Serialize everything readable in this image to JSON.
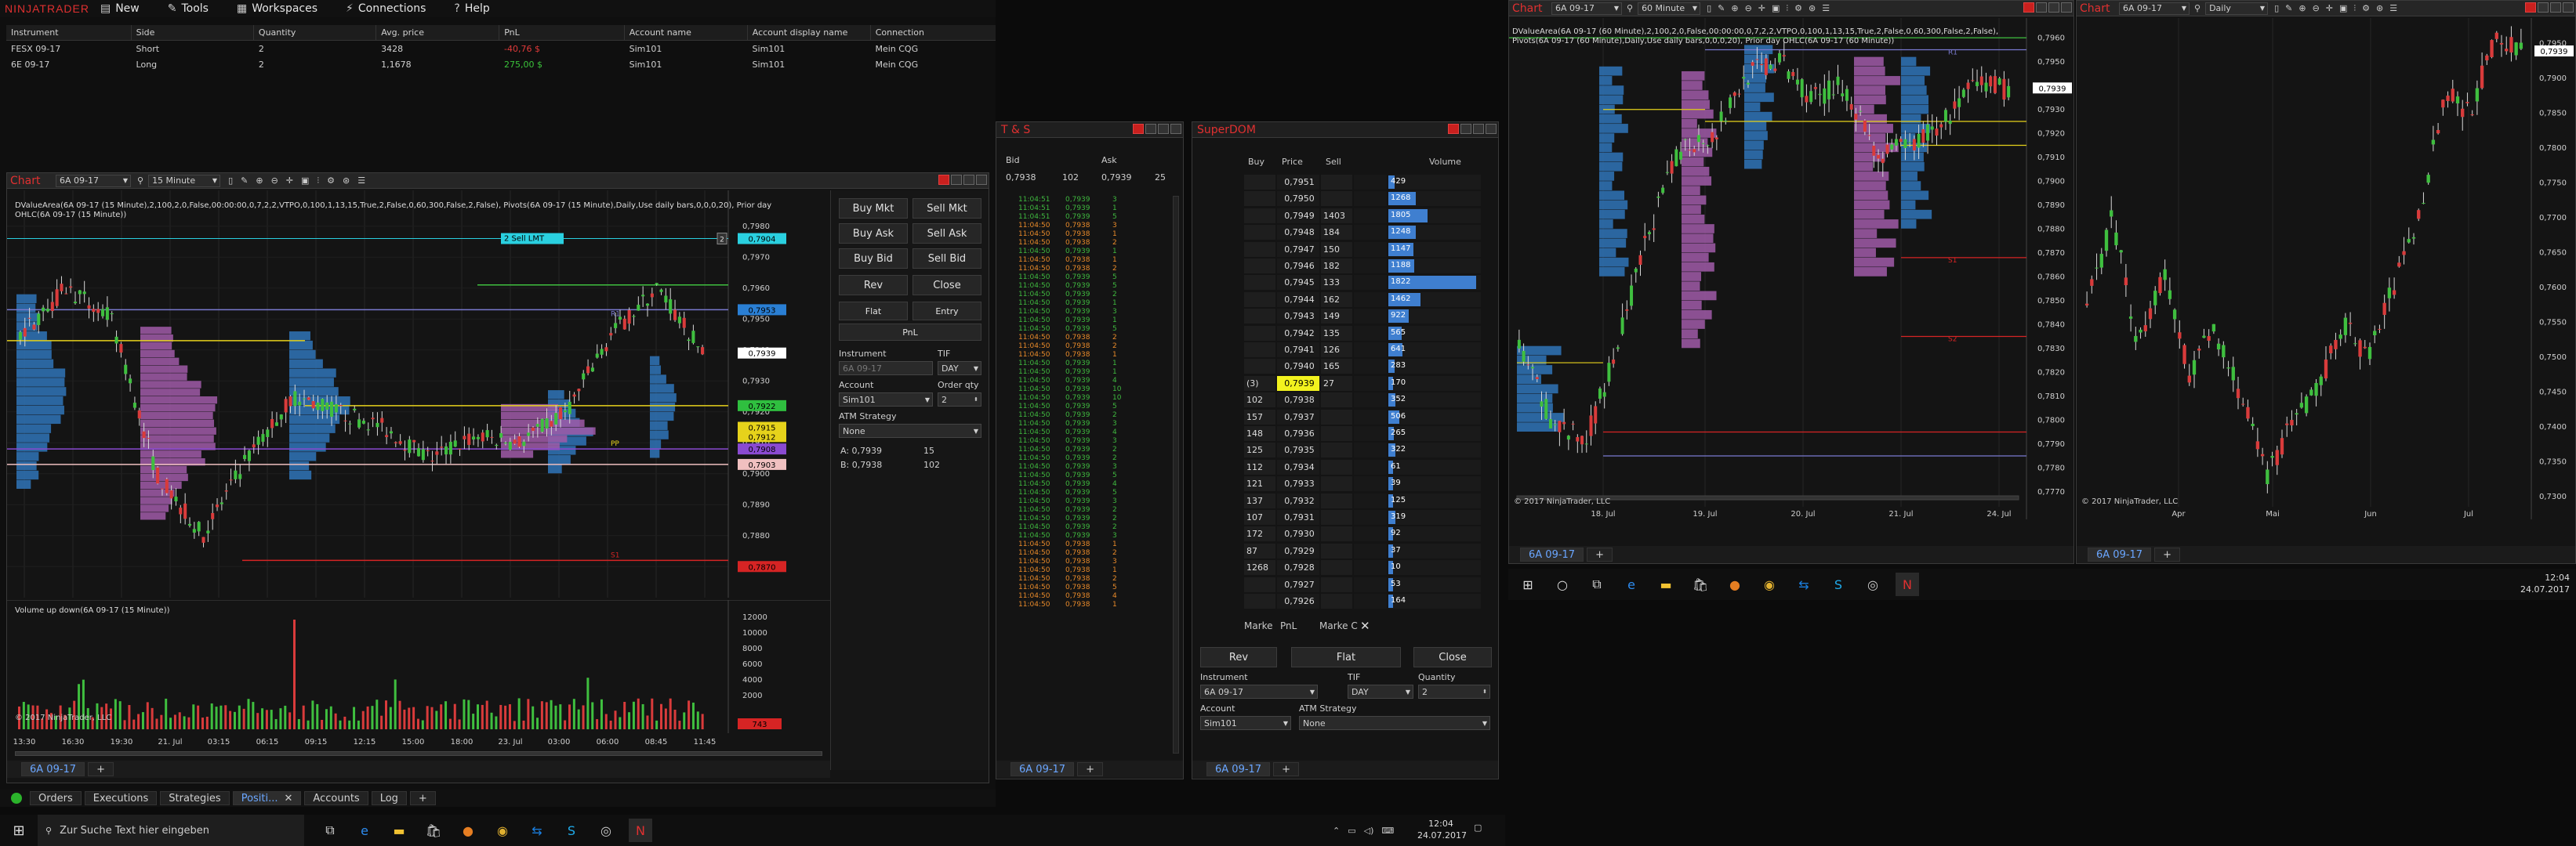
{
  "control_center": {
    "logo": "NINJATRADER",
    "menu": [
      "New",
      "Tools",
      "Workspaces",
      "Connections",
      "Help"
    ],
    "positions_headers": [
      "Instrument",
      "Side",
      "Quantity",
      "Avg. price",
      "PnL",
      "Account name",
      "Account display name",
      "Connection"
    ],
    "positions": [
      {
        "instrument": "FESX 09-17",
        "side": "Short",
        "quantity": "2",
        "avg_price": "3428",
        "pnl": "-40,76 $",
        "account": "Sim101",
        "display": "Sim101",
        "connection": "Mein CQG",
        "pnl_color": "#e03a3a"
      },
      {
        "instrument": "6E 09-17",
        "side": "Long",
        "quantity": "2",
        "avg_price": "1,1678",
        "pnl": "275,00 $",
        "account": "Sim101",
        "display": "Sim101",
        "connection": "Mein CQG",
        "pnl_color": "#3ac23a"
      }
    ],
    "bottom_tabs": [
      "Orders",
      "Executions",
      "Strategies",
      "Positi...",
      "Accounts",
      "Log"
    ],
    "active_bottom_tab": "Positi..."
  },
  "main_chart": {
    "title": "Chart",
    "instrument": "6A 09-17",
    "interval": "15 Minute",
    "info_text": "DValueArea(6A 09-17 (15 Minute),2,100,2,0,False,00:00:00,0,7,2,2,VTPO,0,100,1,13,15,True,2,False,0,60,300,False,2,False), Pivots(6A 09-17 (15 Minute),Daily,Use daily bars,0,0,0,20), Prior day OHLC(6A 09-17 (15 Minute))",
    "sell_order_label": "2  Sell LMT",
    "order_price": "0,7904",
    "order_qty": "2",
    "r1_label": "R1",
    "pp_label": "PP",
    "s1_label": "S1",
    "y_ticks": [
      "0,7980",
      "0,7970",
      "0,7960",
      "0,7950",
      "0,7940",
      "0,7930",
      "0,7920",
      "0,7910",
      "0,7900",
      "0,7890",
      "0,7880",
      "0,7870"
    ],
    "price_tags": [
      {
        "text": "0,7953",
        "bg": "#2a7fd4"
      },
      {
        "text": "0,7939",
        "bg": "#ffffff"
      },
      {
        "text": "0,7922",
        "bg": "#2fbf3f"
      },
      {
        "text": "0,7915",
        "bg": "#e6d21b"
      },
      {
        "text": "0,7912",
        "bg": "#e6d21b"
      },
      {
        "text": "0,7908",
        "bg": "#8a4ad1"
      },
      {
        "text": "0,7903",
        "bg": "#f0c0c0"
      },
      {
        "text": "0,7870",
        "bg": "#d62424"
      }
    ],
    "volume_label": "Volume up down(6A 09-17 (15 Minute))",
    "volume_ticks": [
      "12000",
      "10000",
      "8000",
      "6000",
      "4000",
      "2000"
    ],
    "volume_last": "743",
    "copyright": "© 2017 NinjaTrader, LLC",
    "x_ticks": [
      "13:30",
      "16:30",
      "19:30",
      "21. Jul",
      "03:15",
      "06:15",
      "09:15",
      "12:15",
      "15:00",
      "18:00",
      "23. Jul",
      "03:00",
      "06:00",
      "08:45",
      "11:45"
    ],
    "tab": "6A 09-17"
  },
  "chart_trader": {
    "buy_mkt": "Buy Mkt",
    "sell_mkt": "Sell Mkt",
    "buy_ask": "Buy Ask",
    "sell_ask": "Sell Ask",
    "buy_bid": "Buy Bid",
    "sell_bid": "Sell Bid",
    "rev": "Rev",
    "close": "Close",
    "flat": "Flat",
    "entry": "Entry",
    "pnl": "PnL",
    "instrument_label": "Instrument",
    "instrument_value": "6A 09-17",
    "tif_label": "TIF",
    "tif_value": "DAY",
    "account_label": "Account",
    "account_value": "Sim101",
    "order_qty_label": "Order qty",
    "order_qty_value": "2",
    "atm_label": "ATM Strategy",
    "atm_value": "None",
    "ask_line": "A:  0,7939",
    "ask_size": "15",
    "bid_line": "B:  0,7938",
    "bid_size": "102"
  },
  "ts": {
    "title": "T & S",
    "bid_label": "Bid",
    "ask_label": "Ask",
    "bid_price": "0,7938",
    "bid_size": "102",
    "ask_price": "0,7939",
    "ask_size": "25",
    "rows": [
      [
        "11:04:51",
        "0,7939",
        "3",
        "g"
      ],
      [
        "11:04:51",
        "0,7939",
        "1",
        "g"
      ],
      [
        "11:04:51",
        "0,7939",
        "5",
        "g"
      ],
      [
        "11:04:50",
        "0,7938",
        "3",
        "o"
      ],
      [
        "11:04:50",
        "0,7938",
        "1",
        "o"
      ],
      [
        "11:04:50",
        "0,7938",
        "2",
        "o"
      ],
      [
        "11:04:50",
        "0,7939",
        "1",
        "g"
      ],
      [
        "11:04:50",
        "0,7938",
        "1",
        "o"
      ],
      [
        "11:04:50",
        "0,7938",
        "2",
        "o"
      ],
      [
        "11:04:50",
        "0,7939",
        "5",
        "g"
      ],
      [
        "11:04:50",
        "0,7939",
        "5",
        "g"
      ],
      [
        "11:04:50",
        "0,7939",
        "2",
        "g"
      ],
      [
        "11:04:50",
        "0,7939",
        "1",
        "g"
      ],
      [
        "11:04:50",
        "0,7939",
        "3",
        "g"
      ],
      [
        "11:04:50",
        "0,7939",
        "1",
        "g"
      ],
      [
        "11:04:50",
        "0,7939",
        "5",
        "g"
      ],
      [
        "11:04:50",
        "0,7938",
        "2",
        "o"
      ],
      [
        "11:04:50",
        "0,7938",
        "2",
        "o"
      ],
      [
        "11:04:50",
        "0,7938",
        "1",
        "o"
      ],
      [
        "11:04:50",
        "0,7939",
        "1",
        "g"
      ],
      [
        "11:04:50",
        "0,7939",
        "1",
        "g"
      ],
      [
        "11:04:50",
        "0,7939",
        "4",
        "g"
      ],
      [
        "11:04:50",
        "0,7939",
        "10",
        "g"
      ],
      [
        "11:04:50",
        "0,7939",
        "10",
        "g"
      ],
      [
        "11:04:50",
        "0,7939",
        "5",
        "g"
      ],
      [
        "11:04:50",
        "0,7939",
        "2",
        "g"
      ],
      [
        "11:04:50",
        "0,7939",
        "3",
        "g"
      ],
      [
        "11:04:50",
        "0,7939",
        "4",
        "g"
      ],
      [
        "11:04:50",
        "0,7939",
        "3",
        "g"
      ],
      [
        "11:04:50",
        "0,7939",
        "2",
        "g"
      ],
      [
        "11:04:50",
        "0,7939",
        "2",
        "g"
      ],
      [
        "11:04:50",
        "0,7939",
        "3",
        "g"
      ],
      [
        "11:04:50",
        "0,7939",
        "5",
        "g"
      ],
      [
        "11:04:50",
        "0,7939",
        "4",
        "g"
      ],
      [
        "11:04:50",
        "0,7939",
        "5",
        "g"
      ],
      [
        "11:04:50",
        "0,7939",
        "3",
        "g"
      ],
      [
        "11:04:50",
        "0,7939",
        "2",
        "g"
      ],
      [
        "11:04:50",
        "0,7939",
        "2",
        "g"
      ],
      [
        "11:04:50",
        "0,7939",
        "2",
        "g"
      ],
      [
        "11:04:50",
        "0,7939",
        "3",
        "g"
      ],
      [
        "11:04:50",
        "0,7938",
        "1",
        "o"
      ],
      [
        "11:04:50",
        "0,7938",
        "2",
        "o"
      ],
      [
        "11:04:50",
        "0,7938",
        "3",
        "o"
      ],
      [
        "11:04:50",
        "0,7938",
        "1",
        "o"
      ],
      [
        "11:04:50",
        "0,7938",
        "2",
        "o"
      ],
      [
        "11:04:50",
        "0,7938",
        "5",
        "o"
      ],
      [
        "11:04:50",
        "0,7938",
        "4",
        "o"
      ],
      [
        "11:04:50",
        "0,7938",
        "1",
        "o"
      ]
    ],
    "tab": "6A 09-17"
  },
  "dom": {
    "title": "SuperDOM",
    "headers": [
      "Buy",
      "Price",
      "Sell",
      "",
      "Volume"
    ],
    "rows": [
      {
        "buy": "",
        "price": "0,7951",
        "sell": "",
        "vol": "429",
        "w": 0.07
      },
      {
        "buy": "",
        "price": "0,7950",
        "sell": "",
        "vol": "1268",
        "w": 0.3
      },
      {
        "buy": "",
        "price": "0,7949",
        "sell": "1403",
        "vol": "1805",
        "w": 0.42
      },
      {
        "buy": "",
        "price": "0,7948",
        "sell": "184",
        "vol": "1248",
        "w": 0.3
      },
      {
        "buy": "",
        "price": "0,7947",
        "sell": "150",
        "vol": "1147",
        "w": 0.27
      },
      {
        "buy": "",
        "price": "0,7946",
        "sell": "182",
        "vol": "1188",
        "w": 0.28
      },
      {
        "buy": "",
        "price": "0,7945",
        "sell": "133",
        "vol": "1822",
        "w": 0.95
      },
      {
        "buy": "",
        "price": "0,7944",
        "sell": "162",
        "vol": "1462",
        "w": 0.35
      },
      {
        "buy": "",
        "price": "0,7943",
        "sell": "149",
        "vol": "922",
        "w": 0.22
      },
      {
        "buy": "",
        "price": "0,7942",
        "sell": "135",
        "vol": "565",
        "w": 0.14
      },
      {
        "buy": "",
        "price": "0,7941",
        "sell": "126",
        "vol": "641",
        "w": 0.15
      },
      {
        "buy": "",
        "price": "0,7940",
        "sell": "165",
        "vol": "283",
        "w": 0.07
      },
      {
        "buy": "(3)",
        "price": "0,7939",
        "sell": "27",
        "vol": "170",
        "w": 0.04,
        "hl": true
      },
      {
        "buy": "102",
        "price": "0,7938",
        "sell": "",
        "vol": "352",
        "w": 0.08
      },
      {
        "buy": "157",
        "price": "0,7937",
        "sell": "",
        "vol": "506",
        "w": 0.12
      },
      {
        "buy": "148",
        "price": "0,7936",
        "sell": "",
        "vol": "265",
        "w": 0.06
      },
      {
        "buy": "125",
        "price": "0,7935",
        "sell": "",
        "vol": "322",
        "w": 0.08
      },
      {
        "buy": "112",
        "price": "0,7934",
        "sell": "",
        "vol": "61",
        "w": 0.01
      },
      {
        "buy": "121",
        "price": "0,7933",
        "sell": "",
        "vol": "39",
        "w": 0.01
      },
      {
        "buy": "137",
        "price": "0,7932",
        "sell": "",
        "vol": "125",
        "w": 0.03
      },
      {
        "buy": "107",
        "price": "0,7931",
        "sell": "",
        "vol": "319",
        "w": 0.08
      },
      {
        "buy": "172",
        "price": "0,7930",
        "sell": "",
        "vol": "92",
        "w": 0.02
      },
      {
        "buy": "87",
        "price": "0,7929",
        "sell": "",
        "vol": "37",
        "w": 0.01
      },
      {
        "buy": "1268",
        "price": "0,7928",
        "sell": "",
        "vol": "10",
        "w": 0.005
      },
      {
        "buy": "",
        "price": "0,7927",
        "sell": "",
        "vol": "53",
        "w": 0.01
      },
      {
        "buy": "",
        "price": "0,7926",
        "sell": "",
        "vol": "164",
        "w": 0.04
      }
    ],
    "marke_label": "Marke",
    "pnl_label": "PnL",
    "marke_c_label": "Marke  C",
    "rev": "Rev",
    "flat": "Flat",
    "close": "Close",
    "instrument_label": "Instrument",
    "instrument_value": "6A 09-17",
    "tif_label": "TIF",
    "tif_value": "DAY",
    "qty_label": "Quantity",
    "qty_value": "2",
    "account_label": "Account",
    "account_value": "Sim101",
    "atm_label": "ATM Strategy",
    "atm_value": "None",
    "tab": "6A 09-17"
  },
  "chart60": {
    "title": "Chart",
    "instrument": "6A 09-17",
    "interval": "60 Minute",
    "info_text": "DValueArea(6A 09-17 (60 Minute),2,100,2,0,False,00:00:00,0,7,2,2,VTPO,0,100,1,13,15,True,2,False,0,60,300,False,2,False), Pivots(6A 09-17 (60 Minute),Daily,Use daily bars,0,0,0,20), Prior day OHLC(6A 09-17 (60 Minute))",
    "y_ticks": [
      "0,7960",
      "0,7950",
      "0,7940",
      "0,7930",
      "0,7920",
      "0,7910",
      "0,7900",
      "0,7890",
      "0,7880",
      "0,7870",
      "0,7860",
      "0,7850",
      "0,7840",
      "0,7830",
      "0,7820",
      "0,7810",
      "0,7800",
      "0,7790",
      "0,7780",
      "0,7770"
    ],
    "price_tag": "0,7939",
    "x_ticks": [
      "18. Jul",
      "19. Jul",
      "20. Jul",
      "21. Jul",
      "24. Jul"
    ],
    "r1_label": "R1",
    "s1_label": "S1",
    "s2_label": "S2",
    "copyright": "© 2017 NinjaTrader, LLC",
    "tab": "6A 09-17"
  },
  "chart_daily": {
    "title": "Chart",
    "instrument": "6A 09-17",
    "interval": "Daily",
    "y_ticks": [
      "0,7950",
      "0,7900",
      "0,7850",
      "0,7800",
      "0,7750",
      "0,7700",
      "0,7650",
      "0,7600",
      "0,7550",
      "0,7500",
      "0,7450",
      "0,7400",
      "0,7350",
      "0,7300"
    ],
    "price_tag": "0,7939",
    "x_ticks": [
      "Apr",
      "Mai",
      "Jun",
      "Jul"
    ],
    "copyright": "© 2017 NinjaTrader, LLC",
    "tab": "6A 09-17"
  },
  "taskbar_left": {
    "search_placeholder": "Zur Suche Text hier eingeben",
    "time": "12:04",
    "date": "24.07.2017"
  },
  "taskbar_right": {
    "time": "12:04",
    "date": "24.07.2017"
  }
}
